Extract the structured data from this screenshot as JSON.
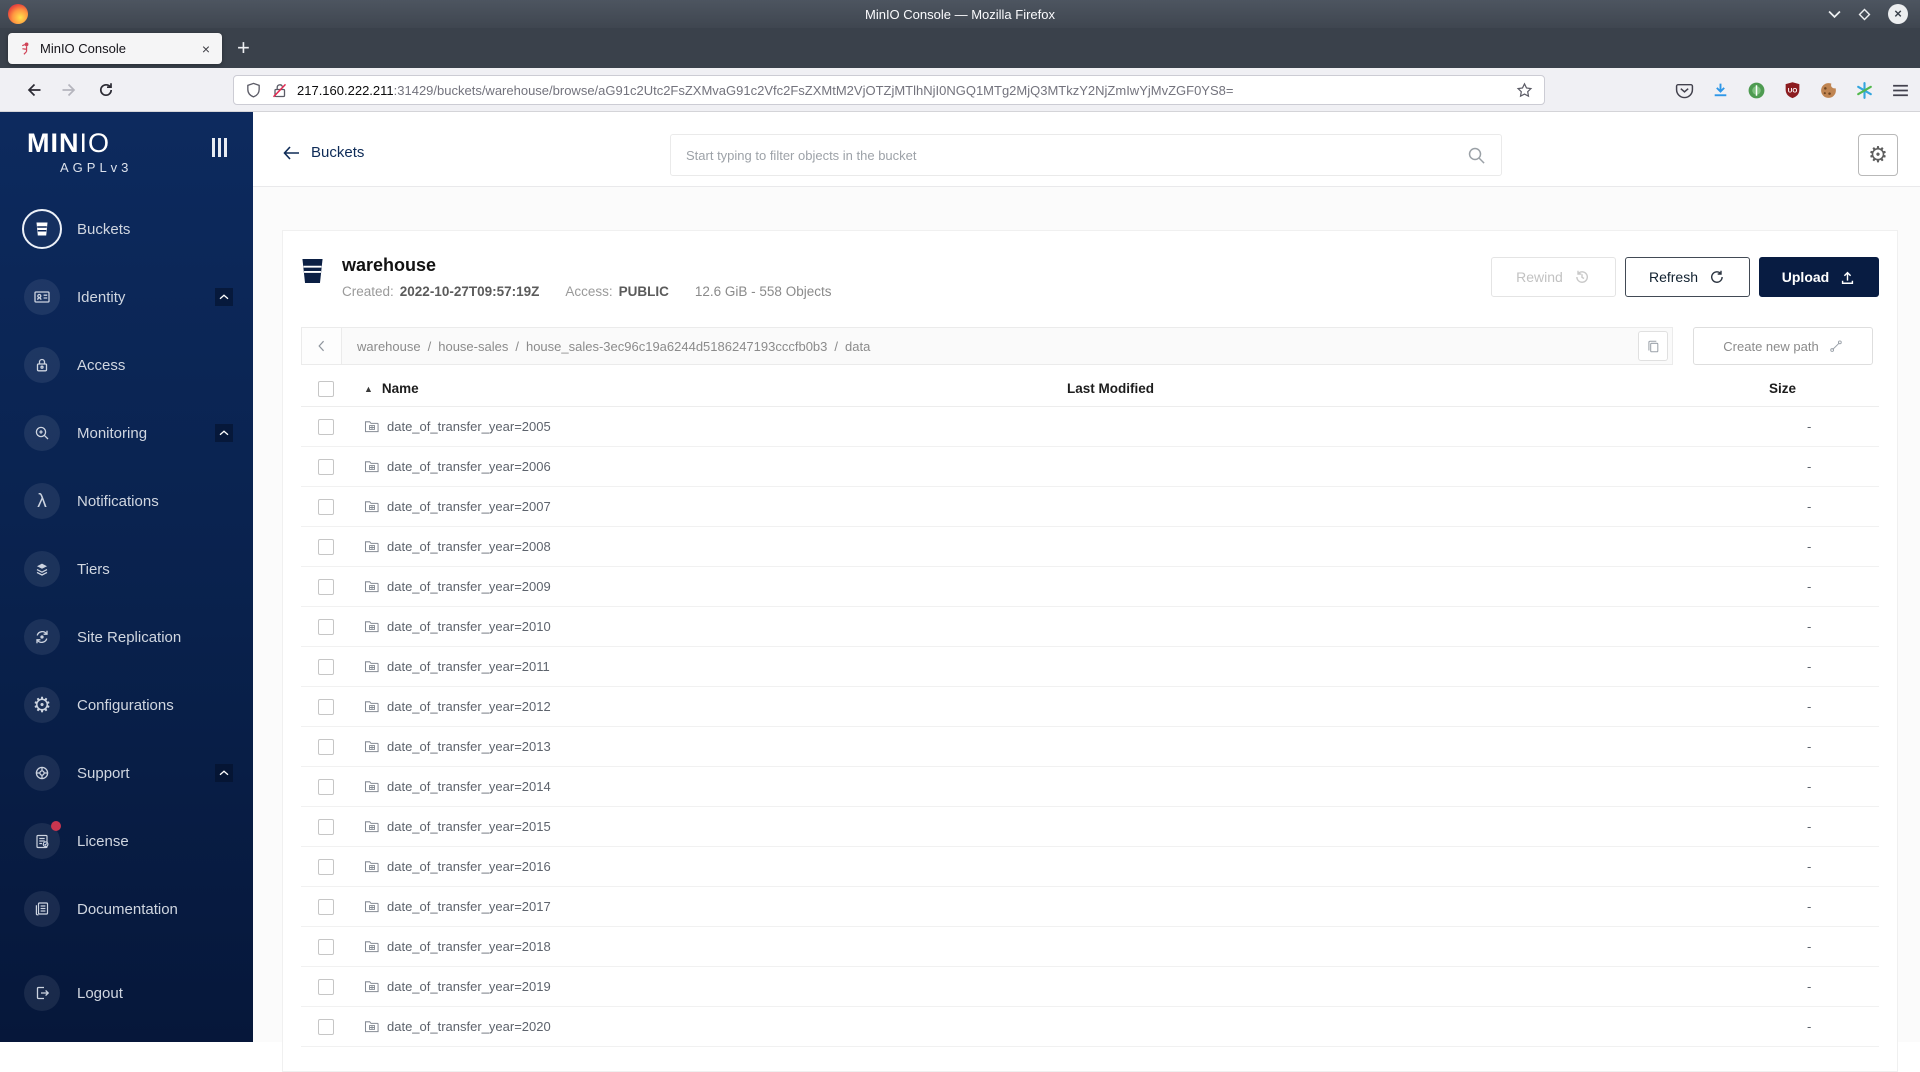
{
  "window": {
    "title": "MinIO Console — Mozilla Firefox",
    "tab": {
      "title": "MinIO Console",
      "close_glyph": "×",
      "new_tab_glyph": "+"
    },
    "url": {
      "host": "217.160.222.211",
      "rest": ":31429/buckets/warehouse/browse/aG91c2Utc2FsZXMvaG91c2Vfc2FsZXMtM2VjOTZjMTlhNjI0NGQ1MTg2MjQ3MTkzY2NjZmIwYjMvZGF0YS8="
    }
  },
  "sidebar": {
    "brand_bold": "MIN",
    "brand_light": "IO",
    "license_tag": "AGPLv3",
    "items": [
      {
        "label": "Buckets"
      },
      {
        "label": "Identity"
      },
      {
        "label": "Access"
      },
      {
        "label": "Monitoring"
      },
      {
        "label": "Notifications"
      },
      {
        "label": "Tiers"
      },
      {
        "label": "Site Replication"
      },
      {
        "label": "Configurations"
      },
      {
        "label": "Support"
      },
      {
        "label": "License"
      },
      {
        "label": "Documentation"
      },
      {
        "label": "Logout"
      }
    ],
    "glyphs": {
      "notifications": "λ",
      "configurations": "⚙"
    }
  },
  "header": {
    "back_label": "Buckets",
    "search_placeholder": "Start typing to filter objects in the bucket",
    "gear_glyph": "⚙"
  },
  "bucket": {
    "name": "warehouse",
    "created_label": "Created:",
    "created": "2022-10-27T09:57:19Z",
    "access_label": "Access:",
    "access": "PUBLIC",
    "usage": "12.6 GiB - 558 Objects",
    "actions": {
      "rewind": "Rewind",
      "refresh": "Refresh",
      "upload": "Upload"
    }
  },
  "pathbar": {
    "separator": "/",
    "segments": [
      "warehouse",
      "house-sales",
      "house_sales-3ec96c19a6244d5186247193cccfb0b3",
      "data"
    ],
    "create_new_path": "Create new path"
  },
  "table": {
    "sort_indicator": "▲",
    "columns": [
      "Name",
      "Last Modified",
      "Size"
    ],
    "rows": [
      {
        "name": "date_of_transfer_year=2005",
        "size": "-"
      },
      {
        "name": "date_of_transfer_year=2006",
        "size": "-"
      },
      {
        "name": "date_of_transfer_year=2007",
        "size": "-"
      },
      {
        "name": "date_of_transfer_year=2008",
        "size": "-"
      },
      {
        "name": "date_of_transfer_year=2009",
        "size": "-"
      },
      {
        "name": "date_of_transfer_year=2010",
        "size": "-"
      },
      {
        "name": "date_of_transfer_year=2011",
        "size": "-"
      },
      {
        "name": "date_of_transfer_year=2012",
        "size": "-"
      },
      {
        "name": "date_of_transfer_year=2013",
        "size": "-"
      },
      {
        "name": "date_of_transfer_year=2014",
        "size": "-"
      },
      {
        "name": "date_of_transfer_year=2015",
        "size": "-"
      },
      {
        "name": "date_of_transfer_year=2016",
        "size": "-"
      },
      {
        "name": "date_of_transfer_year=2017",
        "size": "-"
      },
      {
        "name": "date_of_transfer_year=2018",
        "size": "-"
      },
      {
        "name": "date_of_transfer_year=2019",
        "size": "-"
      },
      {
        "name": "date_of_transfer_year=2020",
        "size": "-"
      }
    ]
  },
  "colors": {
    "navy": "#081c42",
    "sidebar_top": "#0d2a5e",
    "badge_red": "#c9354f",
    "link_navy": "#0e2b57"
  }
}
